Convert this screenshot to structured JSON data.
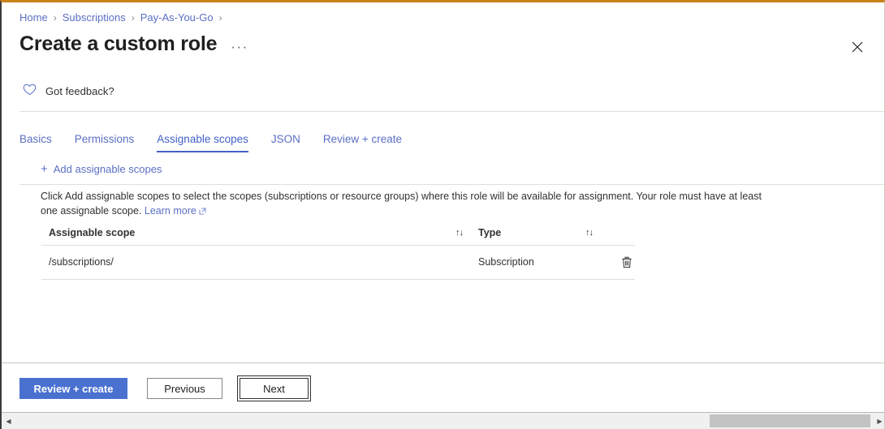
{
  "window": {
    "accent_top_color": "#c8821a",
    "link_color": "#5b6fc4",
    "primary_button_color": "#4a71d0"
  },
  "breadcrumb": {
    "items": [
      {
        "label": "Home"
      },
      {
        "label": "Subscriptions"
      },
      {
        "label": "Pay-As-You-Go"
      }
    ],
    "separator": "›"
  },
  "header": {
    "title": "Create a custom role",
    "ellipsis": "···",
    "close_icon": "close-icon"
  },
  "feedback": {
    "icon": "heart-icon",
    "label": "Got feedback?"
  },
  "tabs": [
    {
      "label": "Basics",
      "active": false
    },
    {
      "label": "Permissions",
      "active": false
    },
    {
      "label": "Assignable scopes",
      "active": true
    },
    {
      "label": "JSON",
      "active": false
    },
    {
      "label": "Review + create",
      "active": false
    }
  ],
  "command_bar": {
    "add_scope_label": "Add assignable scopes",
    "plus_glyph": "+"
  },
  "description": {
    "text": "Click Add assignable scopes to select the scopes (subscriptions or resource groups) where this role will be available for assignment. Your role must have at least one assignable scope.",
    "learn_more_label": "Learn more"
  },
  "table": {
    "columns": [
      {
        "label": "Assignable scope",
        "sort_glyph": "↑↓"
      },
      {
        "label": "Type",
        "sort_glyph": "↑↓"
      }
    ],
    "rows": [
      {
        "scope": "/subscriptions/",
        "type": "Subscription",
        "delete_icon": "trash-icon"
      }
    ]
  },
  "footer": {
    "review_label": "Review + create",
    "previous_label": "Previous",
    "next_label": "Next"
  },
  "scrollbar": {
    "left_arrow": "◀",
    "right_arrow": "▶"
  }
}
